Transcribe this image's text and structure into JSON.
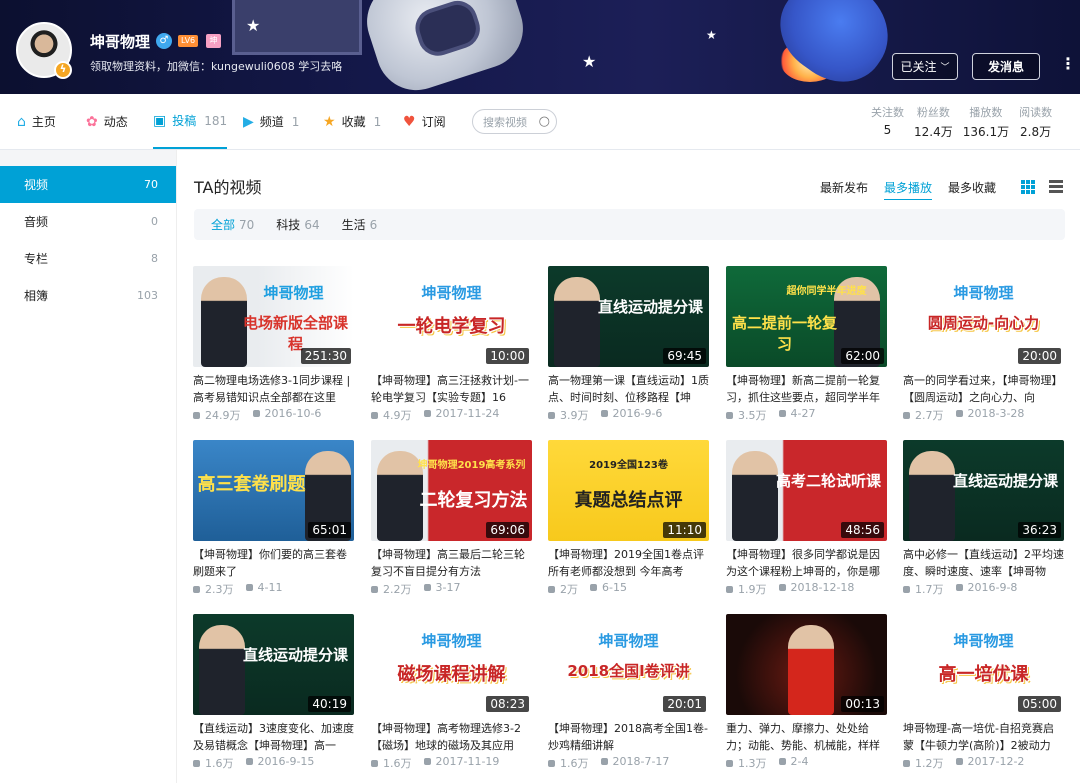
{
  "header": {
    "username": "坤哥物理",
    "badge_lv": "LV6",
    "badge_vip": "坤",
    "sign": "领取物理资料，加微信：kungewuli0608 学习去咯",
    "follow_label": "已关注",
    "message_label": "发消息",
    "more": "⋮"
  },
  "nav": {
    "items": [
      {
        "label": "主页",
        "count": "",
        "icon": "home-icon"
      },
      {
        "label": "动态",
        "count": "",
        "icon": "flower-icon"
      },
      {
        "label": "投稿",
        "count": "181",
        "icon": "upload-icon"
      },
      {
        "label": "频道",
        "count": "1",
        "icon": "channel-icon"
      },
      {
        "label": "收藏",
        "count": "1",
        "icon": "star-icon"
      },
      {
        "label": "订阅",
        "count": "",
        "icon": "heart-icon"
      }
    ],
    "search_placeholder": "搜索视频"
  },
  "stats": [
    {
      "label": "关注数",
      "value": "5"
    },
    {
      "label": "粉丝数",
      "value": "12.4万"
    },
    {
      "label": "播放数",
      "value": "136.1万"
    },
    {
      "label": "阅读数",
      "value": "2.8万"
    }
  ],
  "sidebar": [
    {
      "label": "视频",
      "count": "70"
    },
    {
      "label": "音频",
      "count": "0"
    },
    {
      "label": "专栏",
      "count": "8"
    },
    {
      "label": "相簿",
      "count": "103"
    }
  ],
  "main": {
    "title": "TA的视频",
    "sort": [
      "最新发布",
      "最多播放",
      "最多收藏"
    ],
    "filters": [
      {
        "label": "全部",
        "count": "70"
      },
      {
        "label": "科技",
        "count": "64"
      },
      {
        "label": "生活",
        "count": "6"
      }
    ]
  },
  "videos": [
    {
      "title": "高二物理电场选修3-1同步课程 | 高考易错知识点全部都在这里",
      "plays": "24.9万",
      "date": "2016-10-6",
      "duration": "251:30",
      "thumb_text": "电场新版全部课程",
      "brand": "坤哥物理"
    },
    {
      "title": "【坤哥物理】高三汪拯救计划-一轮电学复习【实验专题】16",
      "plays": "4.9万",
      "date": "2017-11-24",
      "duration": "10:00",
      "thumb_text": "一轮电学复习",
      "brand": "坤哥物理"
    },
    {
      "title": "高一物理第一课【直线运动】1质点、时间时刻、位移路程【坤",
      "plays": "3.9万",
      "date": "2016-9-6",
      "duration": "69:45",
      "thumb_text": "直线运动提分课",
      "brand": ""
    },
    {
      "title": "【坤哥物理】新高二提前一轮复习，抓住这些要点，超同学半年",
      "plays": "3.5万",
      "date": "4-27",
      "duration": "62:00",
      "thumb_text": "高二提前一轮复习",
      "brand": "超你同学半年进度"
    },
    {
      "title": "高一的同学看过来，【坤哥物理】【圆周运动】之向心力、向",
      "plays": "2.7万",
      "date": "2018-3-28",
      "duration": "20:00",
      "thumb_text": "圆周运动-向心力",
      "brand": "坤哥物理"
    },
    {
      "title": "【坤哥物理】你们要的高三套卷刷题来了",
      "plays": "2.3万",
      "date": "4-11",
      "duration": "65:01",
      "thumb_text": "高三套卷刷题",
      "brand": ""
    },
    {
      "title": "【坤哥物理】高三最后二轮三轮复习不盲目提分有方法",
      "plays": "2.2万",
      "date": "3-17",
      "duration": "69:06",
      "thumb_text": "二轮复习方法",
      "brand": "坤哥物理2019高考系列"
    },
    {
      "title": "【坤哥物理】2019全国1卷点评 所有老师都没想到 今年高考",
      "plays": "2万",
      "date": "6-15",
      "duration": "11:10",
      "thumb_text": "真题总结点评",
      "brand": "2019全国123卷"
    },
    {
      "title": "【坤哥物理】很多同学都说是因为这个课程粉上坤哥的，你是哪",
      "plays": "1.9万",
      "date": "2018-12-18",
      "duration": "48:56",
      "thumb_text": "高考二轮试听课",
      "brand": ""
    },
    {
      "title": "高中必修一【直线运动】2平均速度、瞬时速度、速率【坤哥物",
      "plays": "1.7万",
      "date": "2016-9-8",
      "duration": "36:23",
      "thumb_text": "直线运动提分课",
      "brand": ""
    },
    {
      "title": "【直线运动】3速度变化、加速度及易错概念【坤哥物理】高一",
      "plays": "1.6万",
      "date": "2016-9-15",
      "duration": "40:19",
      "thumb_text": "直线运动提分课",
      "brand": ""
    },
    {
      "title": "【坤哥物理】高考物理选修3-2【磁场】地球的磁场及其应用",
      "plays": "1.6万",
      "date": "2017-11-19",
      "duration": "08:23",
      "thumb_text": "磁场课程讲解",
      "brand": "坤哥物理"
    },
    {
      "title": "【坤哥物理】2018高考全国1卷-炒鸡精细讲解",
      "plays": "1.6万",
      "date": "2018-7-17",
      "duration": "20:01",
      "thumb_text": "2018全国I卷评讲",
      "brand": "坤哥物理"
    },
    {
      "title": "重力、弹力、摩擦力、处处给力；动能、势能、机械能，样样",
      "plays": "1.3万",
      "date": "2-4",
      "duration": "00:13",
      "thumb_text": "",
      "brand": ""
    },
    {
      "title": "坤哥物理-高一培优-自招竞赛启蒙【牛顿力学(高阶)】2被动力",
      "plays": "1.2万",
      "date": "2017-12-2",
      "duration": "05:00",
      "thumb_text": "高一培优课",
      "brand": "坤哥物理"
    }
  ],
  "colors": {
    "accent": "#00a1d6",
    "muted": "#99a2aa",
    "banner": "#14184a"
  }
}
